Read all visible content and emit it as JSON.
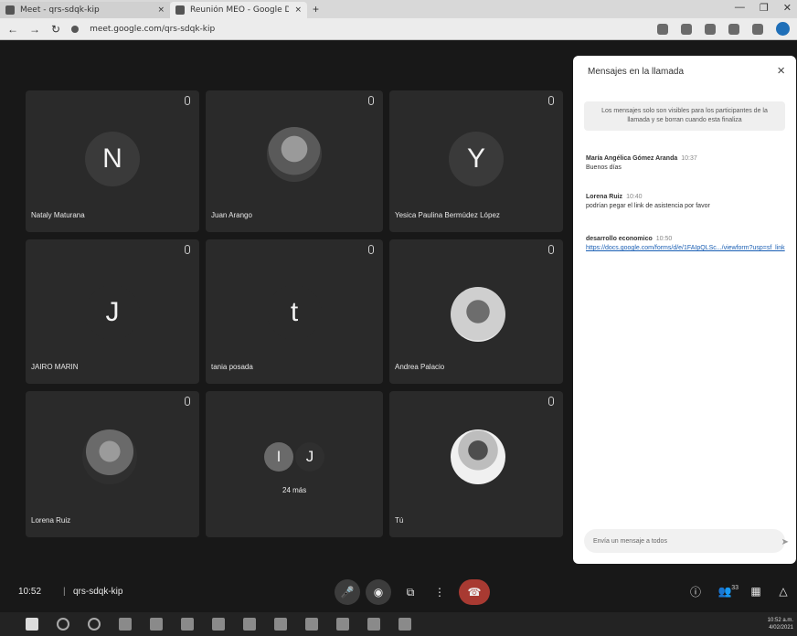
{
  "browser": {
    "tab1": {
      "title": "Meet - qrs-sdqk-kip",
      "close": "×"
    },
    "tab2": {
      "title": "Reunión MEO - Google Drive",
      "close": "×"
    },
    "new_tab": "+",
    "window_controls": [
      "—",
      "❐",
      "✕"
    ],
    "url": "meet.google.com/qrs-sdqk-kip"
  },
  "meeting": {
    "participants": [
      {
        "name": "Nataly Maturana",
        "avatar_type": "letter",
        "letter": "N",
        "avatar_color": "#3a3a3a"
      },
      {
        "name": "Juan Arango",
        "avatar_type": "photo"
      },
      {
        "name": "Yesica Paulina Bermúdez López",
        "avatar_type": "letter",
        "letter": "Y",
        "avatar_color": "#3a3a3a"
      },
      {
        "name": "JAIRO MARIN",
        "avatar_type": "letter",
        "letter": "J",
        "avatar_color": "#2a2a2a"
      },
      {
        "name": "tania posada",
        "avatar_type": "letter",
        "letter": "t",
        "avatar_color": "#2a2a2a"
      },
      {
        "name": "Andrea Palacio",
        "avatar_type": "photo"
      },
      {
        "name": "Lorena Ruiz",
        "avatar_type": "photo"
      },
      {
        "name": "",
        "avatar_type": "more",
        "more_label": "24 más",
        "letters": [
          "I",
          "J"
        ]
      },
      {
        "name": "Tú",
        "avatar_type": "photo"
      }
    ]
  },
  "chat": {
    "title": "Mensajes en la llamada",
    "close_icon": "×",
    "info": "Los mensajes solo son visibles para los participantes de la llamada y se borran cuando esta finaliza",
    "messages": [
      {
        "author": "María Angélica Gómez Aranda",
        "time": "10:37",
        "text": "Buenos días"
      },
      {
        "author": "Lorena Ruiz",
        "time": "10:40",
        "text": "podrían pegar el link de asistencia por favor"
      },
      {
        "author": "desarrollo economico",
        "time": "10:50",
        "text": "https://docs.google.com/forms/d/e/1FAIpQLSc.../viewform?usp=sf_link"
      }
    ],
    "input_placeholder": "Envía un mensaje a todos",
    "send_icon": "➤"
  },
  "controls": {
    "time": "10:52",
    "separator": "|",
    "meeting_code": "qrs-sdqk-kip",
    "buttons": [
      "mic-off",
      "camera-off",
      "present",
      "more",
      "end-call"
    ],
    "right": [
      "info",
      "people",
      "chat",
      "activities"
    ],
    "people_count": "33"
  },
  "taskbar": {
    "clock": "10:52 a.m.",
    "date": "4/02/2021"
  }
}
